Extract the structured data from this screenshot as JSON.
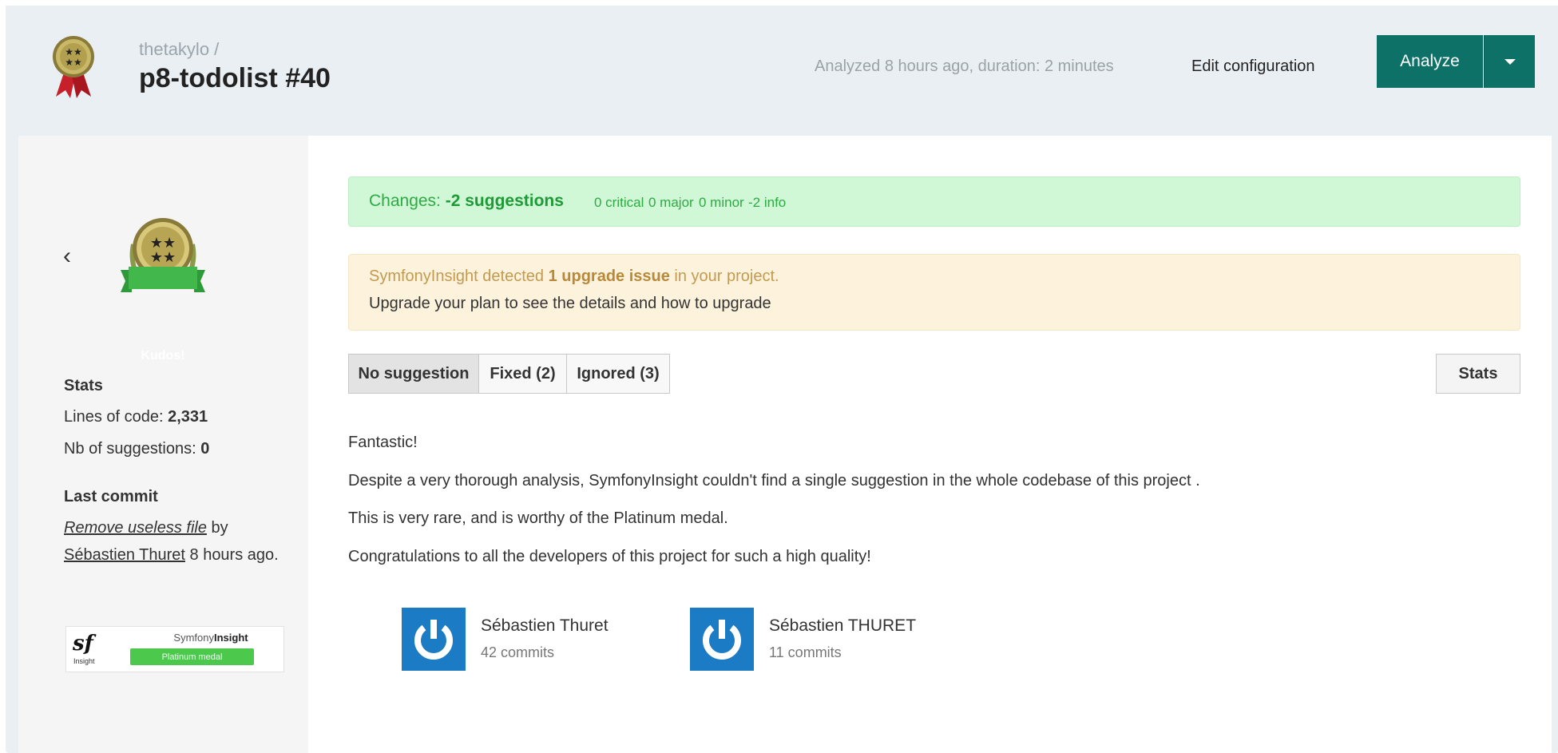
{
  "header": {
    "owner": "thetakylo /",
    "project": "p8-todolist #40",
    "analyzed_text": "Analyzed 8 hours ago, duration: 2 minutes",
    "edit_configuration": "Edit configuration",
    "analyze_label": "Analyze"
  },
  "sidebar": {
    "kudos_label": "Kudos!",
    "stats_heading": "Stats",
    "lines_of_code_label": "Lines of code: ",
    "lines_of_code_value": "2,331",
    "suggestions_label": "Nb of suggestions: ",
    "suggestions_value": "0",
    "last_commit_heading": "Last commit",
    "commit_message": "Remove useless file",
    "commit_by": " by ",
    "commit_author": "Sébastien Thuret",
    "commit_time": " 8 hours ago.",
    "badge_logo": "sf",
    "badge_logo_sub": "Insight",
    "badge_brand_a": "Symfony",
    "badge_brand_b": "Insight",
    "badge_medal": "Platinum medal"
  },
  "changes": {
    "label": "Changes: ",
    "suggestions": "-2 suggestions",
    "critical": "0 critical",
    "major": "0 major",
    "minor": "0 minor",
    "info": "-2 info"
  },
  "upgrade": {
    "line1_a": "SymfonyInsight detected ",
    "line1_b": "1 upgrade issue",
    "line1_c": " in your project.",
    "line2": "Upgrade your plan to see the details and how to upgrade"
  },
  "tabs": {
    "no_suggestion": "No suggestion",
    "fixed": "Fixed (2)",
    "ignored": "Ignored (3)",
    "stats": "Stats"
  },
  "content": {
    "p1": "Fantastic!",
    "p2": "Despite a very thorough analysis, SymfonyInsight couldn't find a single suggestion in the whole codebase of this project .",
    "p3": "This is very rare, and is worthy of the Platinum medal.",
    "p4": "Congratulations to all the developers of this project for such a high quality!"
  },
  "developers": [
    {
      "name": "Sébastien Thuret",
      "commits": "42 commits"
    },
    {
      "name": "Sébastien THURET",
      "commits": "11 commits"
    }
  ],
  "colors": {
    "accent": "#0d7168",
    "success_bg": "#d0f7d6",
    "warning_bg": "#fdf3dc",
    "avatar": "#1b7bc4"
  }
}
